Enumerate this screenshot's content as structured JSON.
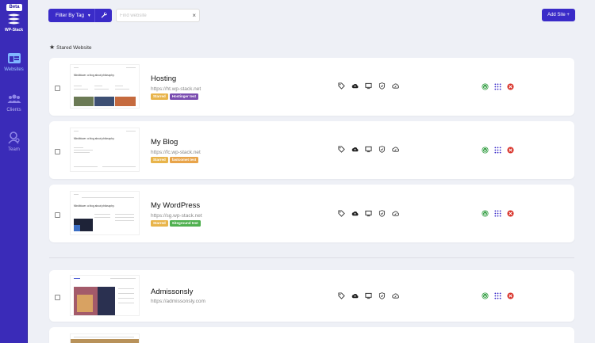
{
  "sidebar": {
    "beta_label": "Beta",
    "brand": "WP-Stack",
    "items": [
      {
        "label": "Websites",
        "icon": "browser-icon",
        "active": true
      },
      {
        "label": "Clients",
        "icon": "users-icon",
        "active": false
      },
      {
        "label": "Team",
        "icon": "user-icon",
        "active": false
      }
    ]
  },
  "toolbar": {
    "filter_label": "Filter By Tag",
    "search_placeholder": "Find website",
    "search_value": "",
    "add_label": "Add Site"
  },
  "section": {
    "title": "Stared Website"
  },
  "colors": {
    "accent": "#3a2bc8",
    "sidebar": "#3a2bb8",
    "tag_starred": "#e8b44a",
    "tag_purple": "#7a4db0",
    "tag_orange": "#e8a44a",
    "tag_green": "#4fb04f",
    "wordpress_green": "#2b9a3b",
    "grid_blue": "#3a2bc8",
    "delete_red": "#d9342b"
  },
  "sites": [
    {
      "name": "Hosting",
      "url": "https://ht.wp-stack.net",
      "tags": [
        {
          "label": "Starred",
          "color": "#e8b44a"
        },
        {
          "label": "Hostinger test",
          "color": "#7a4db0"
        }
      ],
      "thumb_title": "Mindblown: a blog about philosophy."
    },
    {
      "name": "My Blog",
      "url": "https://fc.wp-stack.net",
      "tags": [
        {
          "label": "Starred",
          "color": "#e8b44a"
        },
        {
          "label": "fastcomet test",
          "color": "#e8a44a"
        }
      ],
      "thumb_title": "Mindblown: a blog about philosophy."
    },
    {
      "name": "My WordPress",
      "url": "https://sg.wp-stack.net",
      "tags": [
        {
          "label": "Starred",
          "color": "#e8b44a"
        },
        {
          "label": "Siteground test",
          "color": "#4fb04f"
        }
      ],
      "thumb_title": "Mindblown: a blog about philosophy."
    },
    {
      "name": "Admissonsly",
      "url": "https://admissonsly.com",
      "tags": [],
      "thumb_title": ""
    }
  ]
}
